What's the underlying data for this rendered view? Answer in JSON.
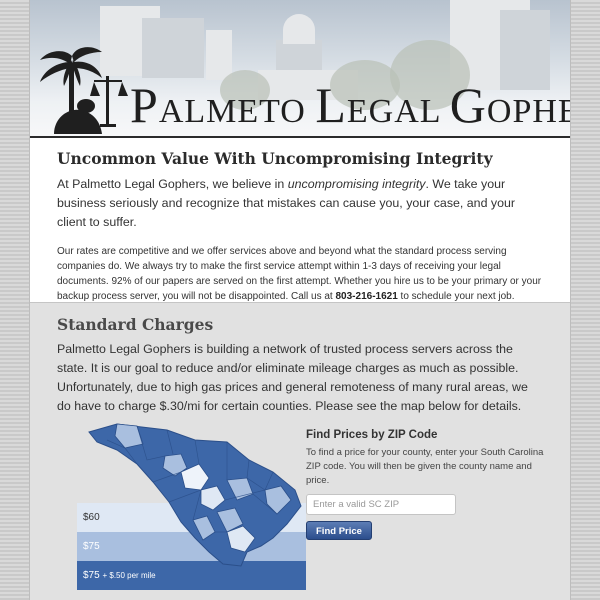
{
  "header": {
    "brand_initial_1": "P",
    "brand_rest_1": "ALMETO ",
    "brand_initial_2": "L",
    "brand_rest_2": "EGAL ",
    "brand_initial_3": "G",
    "brand_rest_3": "OPHERS"
  },
  "intro": {
    "title": "Uncommon Value With Uncompromising Integrity",
    "lead_1": "At Palmetto Legal Gophers, we believe in ",
    "lead_em": "uncompromising integrity",
    "lead_2": ". We take your business seriously and recognize that mistakes can cause you, your case, and your client to suffer.",
    "body_1": "Our rates are competitive and we offer services above and beyond what the standard process serving companies do. We always try to make the first service attempt within 1-3 days of receiving your legal documents. 92% of our papers are served on the first attempt. Whether you hire us to be your primary or your backup process server, you will not be disappointed. Call us at ",
    "phone": "803-216-1621",
    "body_2": " to schedule your next job."
  },
  "charges": {
    "title": "Standard Charges",
    "body": "Palmetto Legal Gophers is building a network of trusted process servers across the state. It is our goal to reduce and/or eliminate mileage charges as much as possible. Unfortunately, due to high gas prices and general remoteness of many rural areas, we do have to charge $.30/mi for certain counties. Please see the map below for details.",
    "legend": [
      {
        "label": "$60",
        "note": "",
        "color": "#dfe8f4"
      },
      {
        "label": "$75",
        "note": "",
        "color": "#a9bfdf"
      },
      {
        "label": "$75",
        "note": "+ $.50 per mile",
        "color": "#3d67a8"
      }
    ]
  },
  "zip": {
    "title": "Find Prices by ZIP Code",
    "description": "To find a price for your county, enter your South Carolina ZIP code. You will then be given the county name and price.",
    "placeholder": "Enter a valid SC ZIP",
    "button_label": "Find Price"
  },
  "colors": {
    "dark_blue": "#3d67a8",
    "mid_blue": "#a9bfdf",
    "light_blue": "#dfe8f4",
    "button": "#2c4e8d"
  }
}
